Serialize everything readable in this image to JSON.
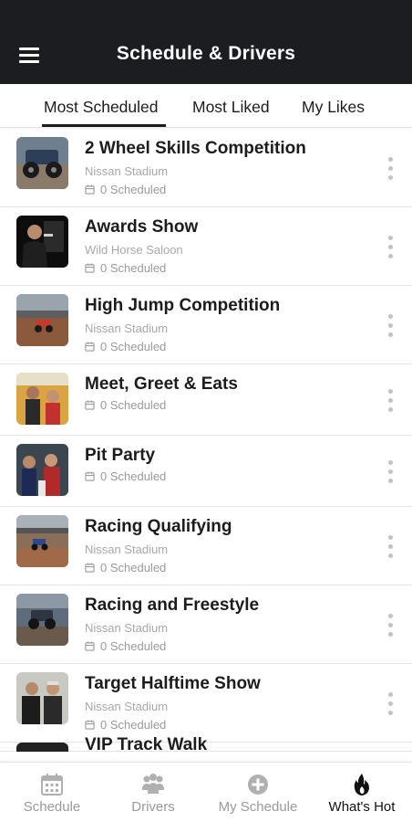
{
  "app": {
    "title": "Schedule & Drivers"
  },
  "tabs": [
    {
      "label": "Most Scheduled",
      "selected": true
    },
    {
      "label": "Most Liked",
      "selected": false
    },
    {
      "label": "My Likes",
      "selected": false
    }
  ],
  "events": [
    {
      "title": "2 Wheel Skills Competition",
      "venue": "Nissan Stadium",
      "scheduled": "0 Scheduled"
    },
    {
      "title": "Awards Show",
      "venue": "Wild Horse Saloon",
      "scheduled": "0 Scheduled"
    },
    {
      "title": "High Jump Competition",
      "venue": "Nissan Stadium",
      "scheduled": "0 Scheduled"
    },
    {
      "title": "Meet, Greet & Eats",
      "venue": "",
      "scheduled": "0 Scheduled"
    },
    {
      "title": "Pit Party",
      "venue": "",
      "scheduled": "0 Scheduled"
    },
    {
      "title": "Racing Qualifying",
      "venue": "Nissan Stadium",
      "scheduled": "0 Scheduled"
    },
    {
      "title": "Racing and Freestyle",
      "venue": "Nissan Stadium",
      "scheduled": "0 Scheduled"
    },
    {
      "title": "Target Halftime Show",
      "venue": "Nissan Stadium",
      "scheduled": "0 Scheduled"
    }
  ],
  "partial_event": {
    "title": "VIP Track Walk"
  },
  "bottom_nav": [
    {
      "label": "Schedule",
      "icon": "calendar-icon",
      "active": false
    },
    {
      "label": "Drivers",
      "icon": "people-icon",
      "active": false
    },
    {
      "label": "My Schedule",
      "icon": "plus-circle-icon",
      "active": false
    },
    {
      "label": "What's Hot",
      "icon": "flame-icon",
      "active": true
    }
  ],
  "colors": {
    "header_bg": "#1b1d20",
    "active_text": "#111111",
    "inactive_text": "#9a9a9a",
    "secondary_text": "#a8a8a8"
  }
}
